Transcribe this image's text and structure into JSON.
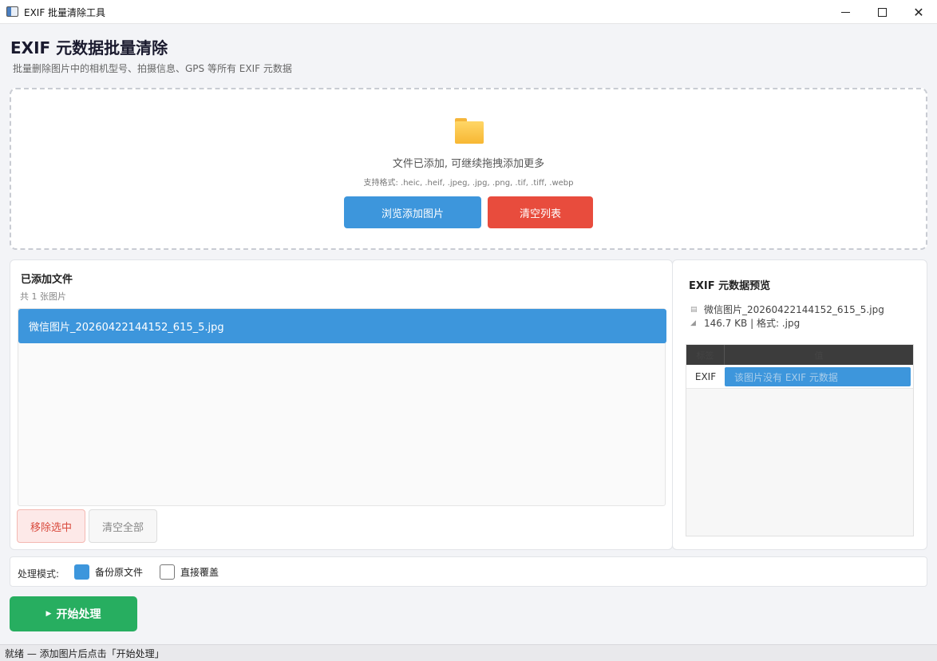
{
  "window": {
    "title": "EXIF 批量清除工具"
  },
  "header": {
    "title": "EXIF 元数据批量清除",
    "subtitle": "批量删除图片中的相机型号、拍摄信息、GPS 等所有 EXIF 元数据"
  },
  "dropzone": {
    "message": "文件已添加, 可继续拖拽添加更多",
    "formats": "支持格式: .heic, .heif, .jpeg, .jpg, .png, .tif, .tiff, .webp",
    "browse_label": "浏览添加图片",
    "clear_label": "清空列表"
  },
  "files": {
    "title": "已添加文件",
    "count": "共 1 张图片",
    "items": [
      "微信图片_20260422144152_615_5.jpg"
    ],
    "remove_label": "移除选中",
    "clear_all_label": "清空全部"
  },
  "preview": {
    "title": "EXIF 元数据预览",
    "file_name": "微信图片_20260422144152_615_5.jpg",
    "file_info": "146.7 KB | 格式: .jpg",
    "table": {
      "headers": [
        "标签",
        "值"
      ],
      "rows": [
        {
          "key": "EXIF",
          "value": "该图片没有 EXIF 元数据"
        }
      ]
    }
  },
  "mode": {
    "label": "处理模式:",
    "options": [
      {
        "label": "备份原文件",
        "checked": true
      },
      {
        "label": "直接覆盖",
        "checked": false
      }
    ]
  },
  "start": {
    "label": "开始处理"
  },
  "status": {
    "text": "就绪 — 添加图片后点击「开始处理」"
  },
  "colors": {
    "accent": "#3d96dc",
    "danger": "#e84c3d",
    "success": "#27ae60"
  }
}
